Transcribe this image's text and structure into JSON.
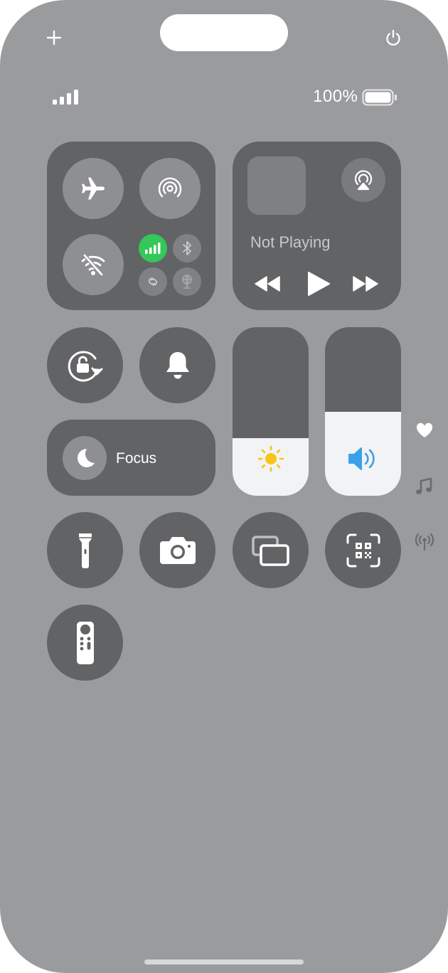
{
  "status": {
    "battery_percent": "100%",
    "battery_level": 1.0
  },
  "connectivity": {
    "airplane_mode": false,
    "airdrop": false,
    "wifi": false,
    "cellular": true,
    "bluetooth": false,
    "hotspot": false,
    "satellite": false
  },
  "now_playing": {
    "title": "Not Playing"
  },
  "focus": {
    "label": "Focus"
  },
  "sliders": {
    "brightness_level": 0.34,
    "volume_level": 0.5
  },
  "colors": {
    "background": "#9a9b9d",
    "tile": "#626365",
    "cellular_active": "#34c759",
    "brightness_icon": "#f5c518",
    "volume_icon": "#3aa0ea"
  },
  "icons": {
    "add": "plus-icon",
    "power": "power-icon",
    "airplane": "airplane-icon",
    "airdrop": "airdrop-icon",
    "wifi": "wifi-off-icon",
    "cellular": "cellular-icon",
    "bluetooth": "bluetooth-icon",
    "hotspot": "hotspot-link-icon",
    "satellite": "satellite-icon",
    "airplay": "airplay-icon",
    "rewind": "rewind-icon",
    "play": "play-icon",
    "forward": "fast-forward-icon",
    "orientation_lock": "orientation-lock-icon",
    "silent": "bell-icon",
    "focus": "moon-icon",
    "brightness": "sun-icon",
    "volume": "speaker-icon",
    "favorites": "heart-icon",
    "music": "music-note-icon",
    "connectivity": "antenna-icon",
    "flashlight": "flashlight-icon",
    "camera": "camera-icon",
    "screen_mirroring": "screen-mirroring-icon",
    "code_scanner": "qr-scanner-icon",
    "remote": "apple-tv-remote-icon"
  }
}
